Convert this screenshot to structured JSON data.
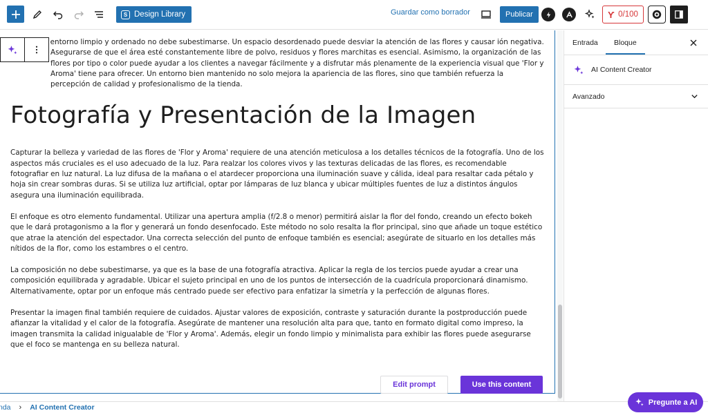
{
  "colors": {
    "wp_blue": "#2271b1",
    "ai_purple": "#6a34d9",
    "score_red": "#d63638",
    "text": "#1e1e1e"
  },
  "toolbar": {
    "design_library_label": "Design Library",
    "design_library_icon": "S",
    "save_draft_label": "Guardar como borrador",
    "publish_label": "Publicar",
    "score_label": "0/100",
    "icons": [
      "plus-icon",
      "pencil-icon",
      "undo-icon",
      "redo-icon",
      "list-view-icon",
      "bolt-icon",
      "a-logo-icon",
      "sparkles-icon",
      "gear-icon",
      "sidebar-toggle-icon"
    ]
  },
  "editor": {
    "intro_paragraph": "ncia de un entorno limpio y ordenado no debe subestimarse. Un espacio desordenado puede desviar la atención de las flores y causar ión negativa. Asegurarse de que el área esté constantemente libre de polvo, residuos y flores marchitas es esencial. Asimismo, la organización de las flores por tipo o color puede ayudar a los clientes a navegar fácilmente y a disfrutar más plenamente de la experiencia visual que 'Flor y Aroma' tiene para ofrecer. Un entorno bien mantenido no solo mejora la apariencia de las flores, sino que también refuerza la percepción de calidad y profesionalismo de la tienda.",
    "heading": "Fotografía y Presentación de la Imagen",
    "paragraphs": [
      "Capturar la belleza y variedad de las flores de 'Flor y Aroma' requiere de una atención meticulosa a los detalles técnicos de la fotografía. Uno de los aspectos más cruciales es el uso adecuado de la luz. Para realzar los colores vivos y las texturas delicadas de las flores, es recomendable fotografiar en luz natural. La luz difusa de la mañana o el atardecer proporciona una iluminación suave y cálida, ideal para resaltar cada pétalo y hoja sin crear sombras duras. Si se utiliza luz artificial, optar por lámparas de luz blanca y ubicar múltiples fuentes de luz a distintos ángulos asegura una iluminación equilibrada.",
      "El enfoque es otro elemento fundamental. Utilizar una apertura amplia (f/2.8 o menor) permitirá aislar la flor del fondo, creando un efecto bokeh que le dará protagonismo a la flor y generará un fondo desenfocado. Este método no solo resalta la flor principal, sino que añade un toque estético que atrae la atención del espectador. Una correcta selección del punto de enfoque también es esencial; asegúrate de situarlo en los detalles más nítidos de la flor, como los estambres o el centro.",
      "La composición no debe subestimarse, ya que es la base de una fotografía atractiva. Aplicar la regla de los tercios puede ayudar a crear una composición equilibrada y agradable. Ubicar el sujeto principal en uno de los puntos de intersección de la cuadrícula proporcionará dinamismo. Alternativamente, optar por un enfoque más centrado puede ser efectivo para enfatizar la simetría y la perfección de algunas flores.",
      "Presentar la imagen final también requiere de cuidados. Ajustar valores de exposición, contraste y saturación durante la postproducción puede afianzar la vitalidad y el calor de la fotografía. Asegúrate de mantener una resolución alta para que, tanto en formato digital como impreso, la imagen transmita la calidad inigualable de 'Flor y Aroma'. Además, elegir un fondo limpio y minimalista para exhibir las flores puede asegurarse que el foco se mantenga en su belleza natural."
    ],
    "edit_prompt_label": "Edit prompt",
    "use_content_label": "Use this content"
  },
  "sidebar": {
    "tabs": [
      {
        "label": "Entrada",
        "active": false
      },
      {
        "label": "Bloque",
        "active": true
      }
    ],
    "block_name": "AI Content Creator",
    "panels": [
      {
        "label": "Avanzado",
        "expanded": false
      }
    ]
  },
  "breadcrumb": {
    "items": [
      "nda",
      "AI Content Creator"
    ]
  },
  "ask_ai_label": "Pregunte a AI"
}
